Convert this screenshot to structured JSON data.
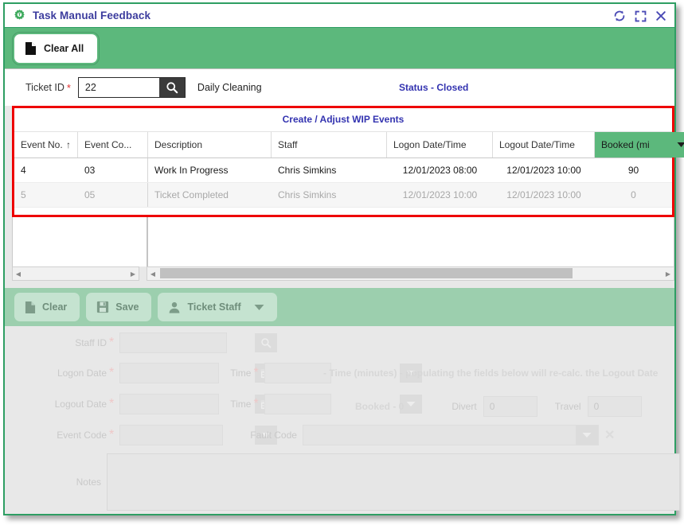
{
  "window": {
    "title": "Task Manual Feedback",
    "icon": "gear-icon",
    "actions": [
      {
        "name": "refresh-icon",
        "label": "Refresh"
      },
      {
        "name": "maximize-icon",
        "label": "Maximize"
      },
      {
        "name": "close-icon",
        "label": "Close"
      }
    ],
    "border_color": "#2e9e63"
  },
  "toolbar": {
    "clear_all_label": "Clear All"
  },
  "ticket": {
    "id_label": "Ticket ID",
    "required_mark": "*",
    "id_value": "22",
    "id_placeholder": "",
    "search_icon": "search-icon",
    "description": "Daily Cleaning",
    "status": "Status -  Closed"
  },
  "grid": {
    "title": "Create / Adjust WIP Events",
    "sort_indicator": "↑",
    "columns": [
      {
        "label": "Event No.",
        "sorted": true
      },
      {
        "label": "Event Co...",
        "sorted": false
      },
      {
        "label": "Description",
        "sorted": false
      },
      {
        "label": "Staff",
        "sorted": false
      },
      {
        "label": "Logon Date/Time",
        "sorted": false
      },
      {
        "label": "Logout Date/Time",
        "sorted": false
      },
      {
        "label": "Booked (mi",
        "sorted": false,
        "highlighted": true
      }
    ],
    "rows": [
      {
        "event_no": "4",
        "event_code": "03",
        "description": "Work In Progress",
        "staff": "Chris Simkins",
        "logon": "12/01/2023 08:00",
        "logout": "12/01/2023 10:00",
        "booked": "90",
        "muted": false
      },
      {
        "event_no": "5",
        "event_code": "05",
        "description": "Ticket Completed",
        "staff": "Chris Simkins",
        "logon": "12/01/2023 10:00",
        "logout": "12/01/2023 10:00",
        "booked": "0",
        "muted": true
      }
    ],
    "highlight_color": "#ee0000"
  },
  "actions": {
    "clear_label": "Clear",
    "save_label": "Save",
    "ticket_staff_label": "Ticket Staff"
  },
  "form": {
    "staff_id_label": "Staff ID",
    "staff_id_value": "",
    "logon_date_label": "Logon Date",
    "logon_date_value": "",
    "logon_time_label": "Time",
    "logon_time_value": "",
    "logout_date_label": "Logout Date",
    "logout_date_value": "",
    "logout_time_label": "Time",
    "logout_time_value": "",
    "time_note": "-  Time (minutes) - populating the fields below will re-calc. the Logout Date",
    "booked_label": "Booked -  0",
    "divert_label": "Divert",
    "divert_value": "0",
    "travel_label": "Travel",
    "travel_value": "0",
    "event_code_label": "Event Code",
    "event_code_value": "",
    "fault_code_label": "Fault Code",
    "fault_code_value": "",
    "fault_code_clear": "✕",
    "notes_label": "Notes",
    "notes_value": ""
  }
}
